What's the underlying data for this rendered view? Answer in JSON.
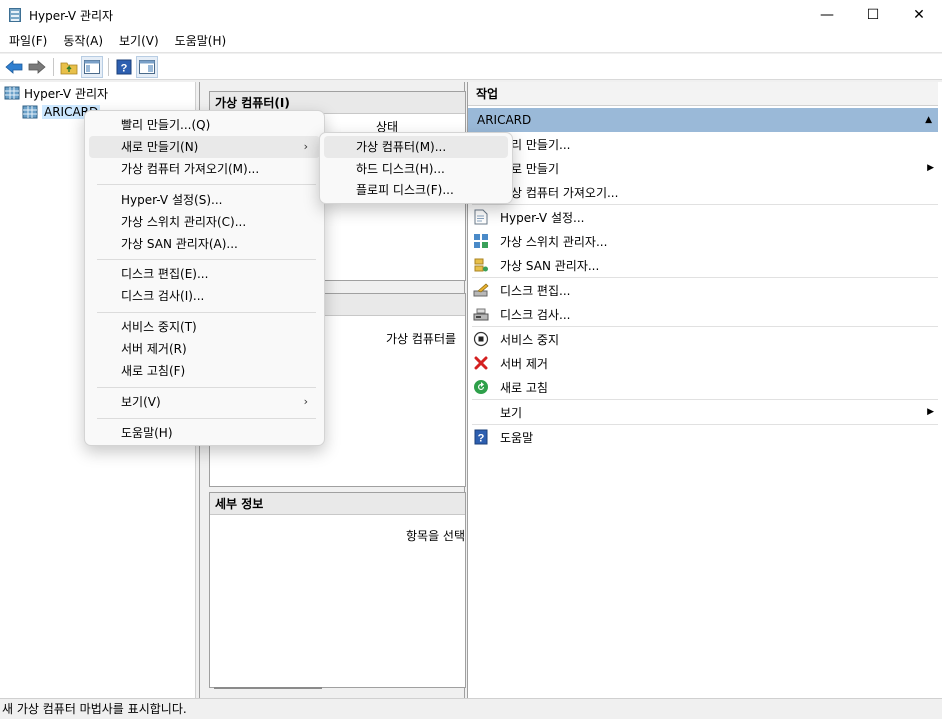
{
  "window": {
    "title": "Hyper-V 관리자",
    "minimize": "—",
    "maximize": "☐",
    "close": "✕"
  },
  "menubar": [
    "파일(F)",
    "동작(A)",
    "보기(V)",
    "도움말(H)"
  ],
  "tree": {
    "root": "Hyper-V 관리자",
    "server": "ARICARD"
  },
  "center": {
    "vm_panel_title": "가상 컴퓨터(I)",
    "vm_col_state": "상태",
    "vm_empty_text": "가상 컴퓨터를",
    "details_title": "세부 정보",
    "details_empty": "항목을 선택"
  },
  "actions": {
    "title": "작업",
    "group": "ARICARD",
    "items": [
      {
        "label": "빨리 만들기..."
      },
      {
        "label": "새로 만들기"
      },
      {
        "label": "가상 컴퓨터 가져오기..."
      },
      {
        "label": "Hyper-V 설정..."
      },
      {
        "label": "가상 스위치 관리자..."
      },
      {
        "label": "가상 SAN 관리자..."
      },
      {
        "label": "디스크 편집..."
      },
      {
        "label": "디스크 검사..."
      },
      {
        "label": "서비스 중지"
      },
      {
        "label": "서버 제거"
      },
      {
        "label": "새로 고침"
      },
      {
        "label": "보기"
      },
      {
        "label": "도움말"
      }
    ]
  },
  "context_menu": {
    "items": [
      "빨리 만들기...(Q)",
      "새로 만들기(N)",
      "가상 컴퓨터 가져오기(M)...",
      "Hyper-V 설정(S)...",
      "가상 스위치 관리자(C)...",
      "가상 SAN 관리자(A)...",
      "디스크 편집(E)...",
      "디스크 검사(I)...",
      "서비스 중지(T)",
      "서버 제거(R)",
      "새로 고침(F)",
      "보기(V)",
      "도움말(H)"
    ]
  },
  "submenu": {
    "items": [
      "가상 컴퓨터(M)...",
      "하드 디스크(H)...",
      "플로피 디스크(F)..."
    ]
  },
  "status": "새 가상 컴퓨터 마법사를 표시합니다."
}
